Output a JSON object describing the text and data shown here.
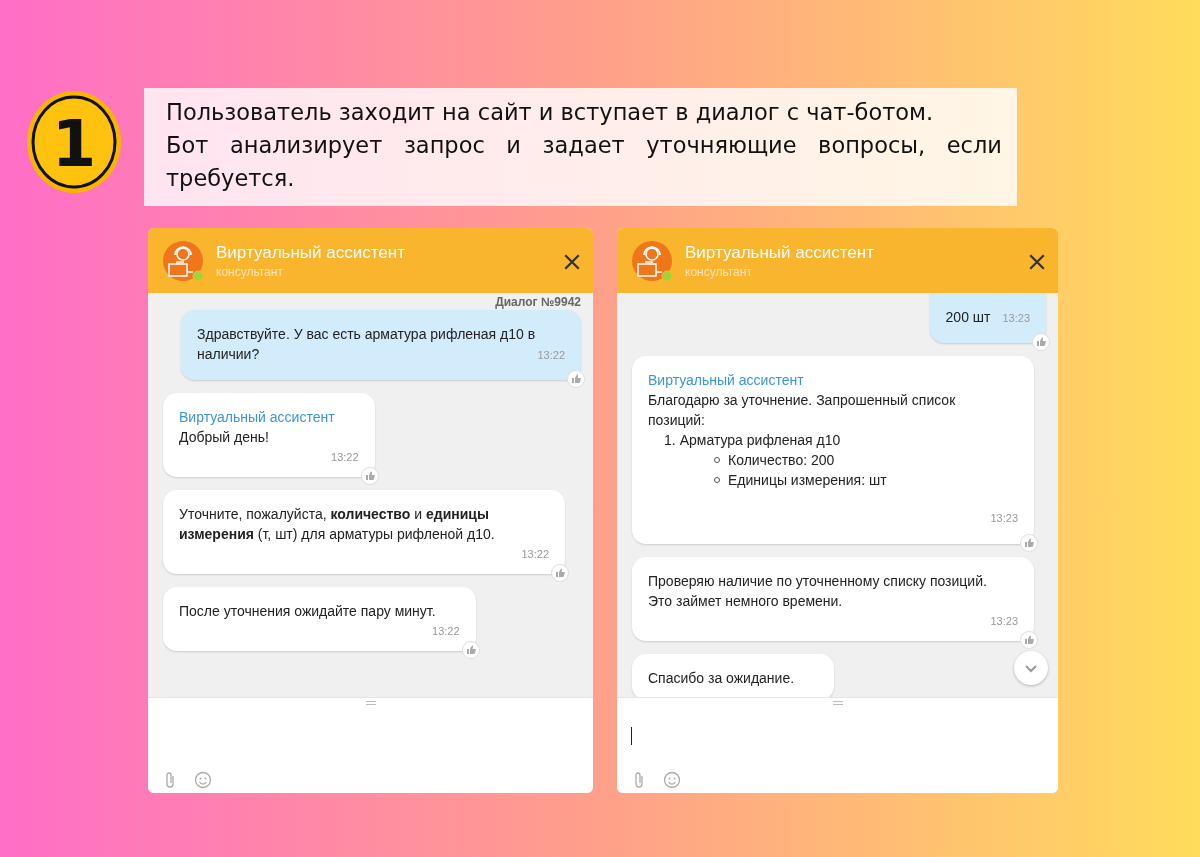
{
  "step": {
    "number": "1"
  },
  "caption": {
    "lines": [
      "Пользователь заходит на сайт и вступает в диалог с чат-ботом.",
      "Бот анализирует запрос и задает уточняющие вопросы, если требуется."
    ]
  },
  "chats": [
    {
      "header": {
        "title": "Виртуальный ассистент",
        "subtitle": "консультант",
        "online": true
      },
      "dialog_label": "Диалог №9942",
      "messages": [
        {
          "kind": "user",
          "text": "Здравствуйте. У вас есть арматура рифленая д10 в наличии?",
          "time": "13:22"
        },
        {
          "kind": "bot",
          "author": "Виртуальный ассистент",
          "text": "Добрый день!",
          "time": "13:22"
        },
        {
          "kind": "bot",
          "text": "Уточните, пожалуйста, **количество** и **единицы измерения** (т, шт) для арматуры рифленой д10.",
          "time": "13:22"
        },
        {
          "kind": "bot",
          "text": "После уточнения ожидайте пару минут.",
          "time": "13:22"
        }
      ],
      "composer": {
        "focused": false
      }
    },
    {
      "header": {
        "title": "Виртуальный ассистент",
        "subtitle": "консультант",
        "online": true
      },
      "scroll_down_button": true,
      "messages": [
        {
          "kind": "user",
          "text": "200 шт",
          "time": "13:23"
        },
        {
          "kind": "bot",
          "author": "Виртуальный ассистент",
          "text": "Благодарю за уточнение. Запрошенный список позиций:",
          "list": [
            {
              "number": "1.",
              "text": "Арматура рифленая д10",
              "children": [
                {
                  "text": "Количество: 200"
                },
                {
                  "text": "Единицы измерения: шт"
                }
              ]
            }
          ],
          "time": "13:23"
        },
        {
          "kind": "bot",
          "text": "Проверяю наличие по уточненному списку позиций. Это займет немного времени.",
          "time": "13:23"
        },
        {
          "kind": "bot",
          "text": "Спасибо за ожидание."
        }
      ],
      "composer": {
        "focused": true
      }
    }
  ]
}
